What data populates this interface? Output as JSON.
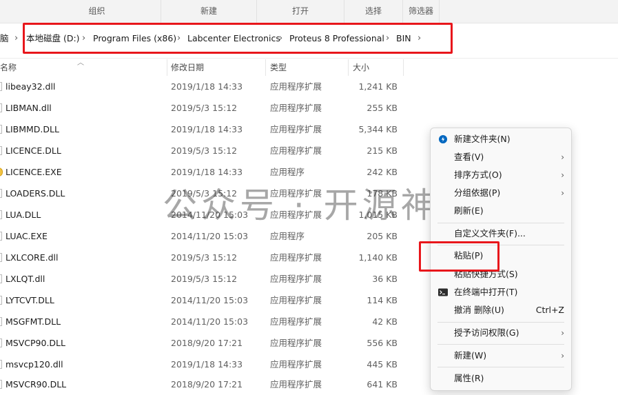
{
  "ribbon": {
    "groups": [
      "组织",
      "新建",
      "打开",
      "选择",
      "筛选器"
    ]
  },
  "address": {
    "crumbs": [
      "脑",
      "本地磁盘 (D:)",
      "Program Files (x86)",
      "Labcenter Electronics",
      "Proteus 8 Professional",
      "BIN"
    ],
    "chevron": "›"
  },
  "columns": {
    "name": "名称",
    "date": "修改日期",
    "type": "类型",
    "size": "大小"
  },
  "files": [
    {
      "name": "libeay32.dll",
      "date": "2019/1/18 14:33",
      "type": "应用程序扩展",
      "size": "1,241 KB"
    },
    {
      "name": "LIBMAN.dll",
      "date": "2019/5/3 15:12",
      "type": "应用程序扩展",
      "size": "255 KB"
    },
    {
      "name": "LIBMMD.DLL",
      "date": "2019/1/18 14:33",
      "type": "应用程序扩展",
      "size": "5,344 KB"
    },
    {
      "name": "LICENCE.DLL",
      "date": "2019/5/3 15:12",
      "type": "应用程序扩展",
      "size": "215 KB"
    },
    {
      "name": "LICENCE.EXE",
      "date": "2019/1/18 14:33",
      "type": "应用程序",
      "size": "242 KB"
    },
    {
      "name": "LOADERS.DLL",
      "date": "2019/5/3 15:12",
      "type": "应用程序扩展",
      "size": "178 KB"
    },
    {
      "name": "LUA.DLL",
      "date": "2014/11/20 15:03",
      "type": "应用程序扩展",
      "size": "1,015 KB"
    },
    {
      "name": "LUAC.EXE",
      "date": "2014/11/20 15:03",
      "type": "应用程序",
      "size": "205 KB"
    },
    {
      "name": "LXLCORE.dll",
      "date": "2019/5/3 15:12",
      "type": "应用程序扩展",
      "size": "1,140 KB"
    },
    {
      "name": "LXLQT.dll",
      "date": "2019/5/3 15:12",
      "type": "应用程序扩展",
      "size": "36 KB"
    },
    {
      "name": "LYTCVT.DLL",
      "date": "2014/11/20 15:03",
      "type": "应用程序扩展",
      "size": "114 KB"
    },
    {
      "name": "MSGFMT.DLL",
      "date": "2014/11/20 15:03",
      "type": "应用程序扩展",
      "size": "42 KB"
    },
    {
      "name": "MSVCP90.DLL",
      "date": "2018/9/20 17:21",
      "type": "应用程序扩展",
      "size": "556 KB"
    },
    {
      "name": "msvcp120.dll",
      "date": "2019/1/18 14:33",
      "type": "应用程序扩展",
      "size": "445 KB"
    },
    {
      "name": "MSVCR90.DLL",
      "date": "2018/9/20 17:21",
      "type": "应用程序扩展",
      "size": "641 KB"
    }
  ],
  "context_menu": {
    "items": [
      {
        "label": "新建文件夹(N)",
        "icon": "new-folder-icon"
      },
      {
        "label": "查看(V)",
        "submenu": "›"
      },
      {
        "label": "排序方式(O)",
        "submenu": "›"
      },
      {
        "label": "分组依据(P)",
        "submenu": "›"
      },
      {
        "label": "刷新(E)"
      },
      {
        "label": "自定义文件夹(F)..."
      },
      {
        "label": "粘贴(P)"
      },
      {
        "label": "粘贴快捷方式(S)"
      },
      {
        "label": "在终端中打开(T)",
        "icon": "terminal-icon"
      },
      {
        "label": "撤消 删除(U)",
        "shortcut": "Ctrl+Z"
      },
      {
        "label": "授予访问权限(G)",
        "submenu": "›"
      },
      {
        "label": "新建(W)",
        "submenu": "›"
      },
      {
        "label": "属性(R)"
      }
    ]
  },
  "watermark": "公众号 · 开源神器",
  "colors": {
    "highlight_red": "#e8161b",
    "accent_blue": "#0067c0"
  }
}
